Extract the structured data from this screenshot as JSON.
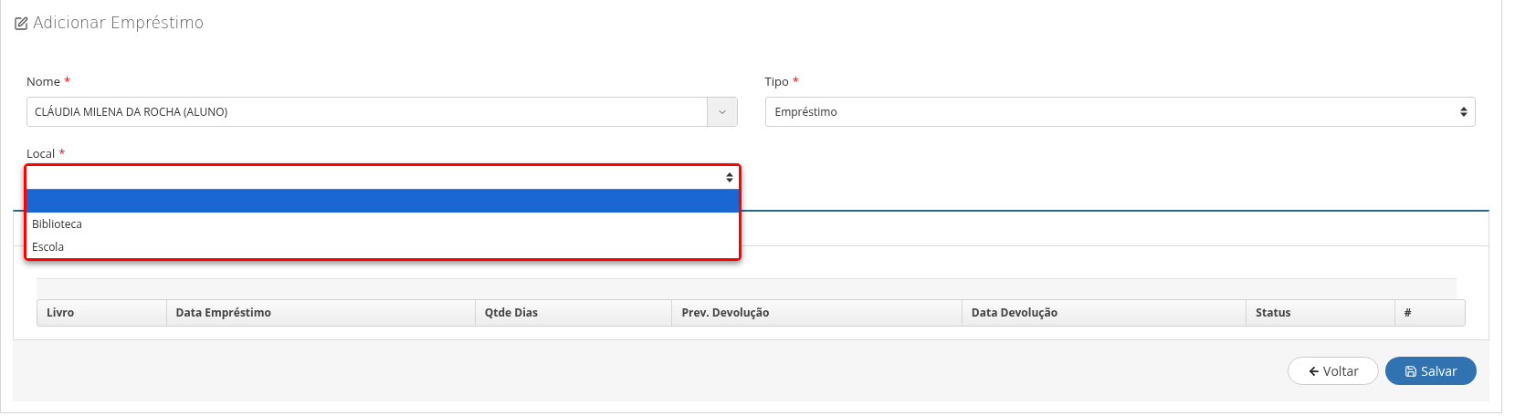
{
  "title": "Adicionar Empréstimo",
  "fields": [
    {
      "kind": "combo",
      "label": "Nome",
      "required_mark": "*",
      "value": "CLÁUDIA MILENA DA ROCHA (ALUNO)"
    },
    {
      "kind": "select",
      "label": "Tipo",
      "required_mark": "*",
      "value": "Empréstimo"
    }
  ],
  "local": {
    "label": "Local",
    "required_mark": "*",
    "expanded": true,
    "options": [
      {
        "selected": true
      },
      {
        "label": "Biblioteca",
        "selected": false
      },
      {
        "label": "Escola",
        "selected": false
      }
    ]
  },
  "table": {
    "columns": [
      "Livro",
      "Data Empréstimo",
      "Qtde Dias",
      "Prev. Devolução",
      "Data Devolução",
      "Status",
      "#"
    ]
  },
  "buttons": [
    {
      "kind": "back",
      "label": "Voltar"
    },
    {
      "kind": "save",
      "label": "Salvar"
    }
  ]
}
